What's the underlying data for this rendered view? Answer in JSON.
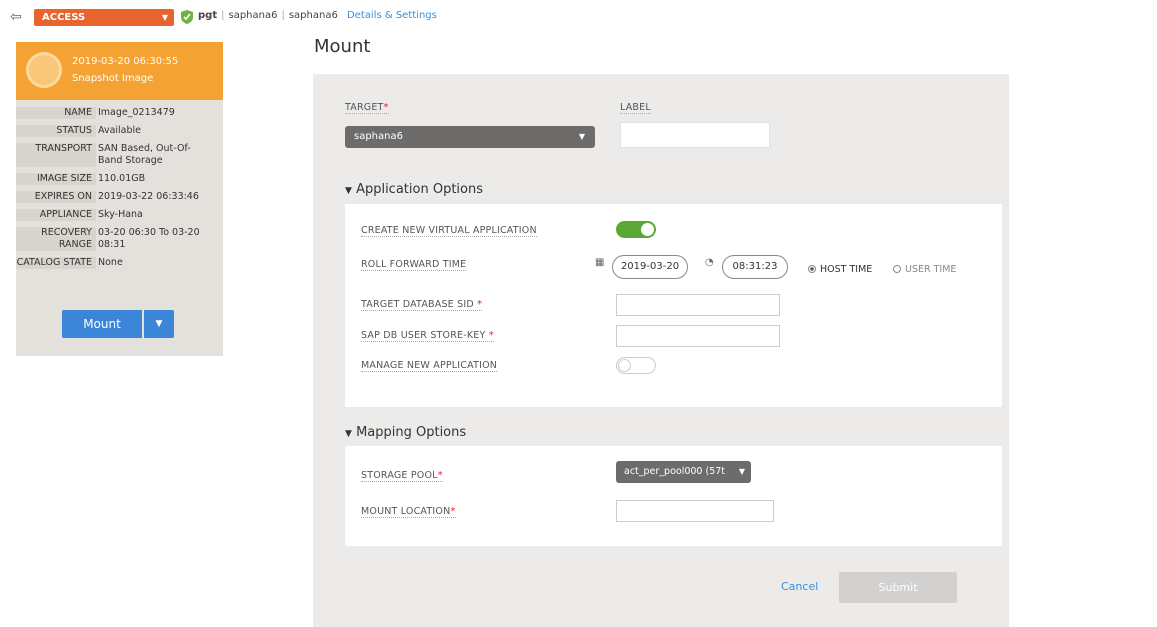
{
  "topbar": {
    "access_label": "ACCESS",
    "crumb_host": "pgt",
    "crumb_app": "saphana6",
    "crumb_target": "saphana6",
    "details_link": "Details & Settings"
  },
  "snapshot": {
    "date": "2019-03-20 06:30:55",
    "type": "Snapshot Image",
    "properties": [
      {
        "key": "NAME",
        "value": "Image_0213479"
      },
      {
        "key": "STATUS",
        "value": "Available"
      },
      {
        "key": "TRANSPORT",
        "value": "SAN Based, Out-Of-Band Storage"
      },
      {
        "key": "IMAGE SIZE",
        "value": "110.01GB"
      },
      {
        "key": "EXPIRES ON",
        "value": "2019-03-22 06:33:46"
      },
      {
        "key": "APPLIANCE",
        "value": "Sky-Hana"
      },
      {
        "key": "RECOVERY RANGE",
        "value": "03-20 06:30 To 03-20 08:31"
      },
      {
        "key": "CATALOG STATE",
        "value": "None"
      }
    ],
    "mount_button": "Mount"
  },
  "page_title": "Mount",
  "form": {
    "target_label": "TARGET",
    "target_value": "saphana6",
    "label_label": "LABEL",
    "label_value": "",
    "required_mark": "*",
    "application_options": {
      "header": "Application Options",
      "create_new_virtual_app_label": "CREATE NEW VIRTUAL APPLICATION",
      "create_new_virtual_app_on": true,
      "roll_forward_label": "ROLL FORWARD TIME",
      "roll_forward_date": "2019-03-20",
      "roll_forward_time": "08:31:23",
      "host_time_label": "HOST TIME",
      "user_time_label": "USER TIME",
      "target_db_sid_label": "TARGET DATABASE SID",
      "sap_user_store_key_label": "SAP DB USER STORE-KEY",
      "manage_new_app_label": "MANAGE NEW APPLICATION",
      "manage_new_app_on": false
    },
    "mapping_options": {
      "header": "Mapping Options",
      "storage_pool_label": "STORAGE POOL",
      "storage_pool_value": "act_per_pool000 (57t",
      "mount_location_label": "MOUNT LOCATION"
    },
    "cancel_label": "Cancel",
    "submit_label": "Submit"
  },
  "colors": {
    "accent_orange": "#f3a233",
    "access_orange": "#e8632e",
    "primary_blue": "#3b86d9",
    "toggle_green": "#59a836"
  }
}
